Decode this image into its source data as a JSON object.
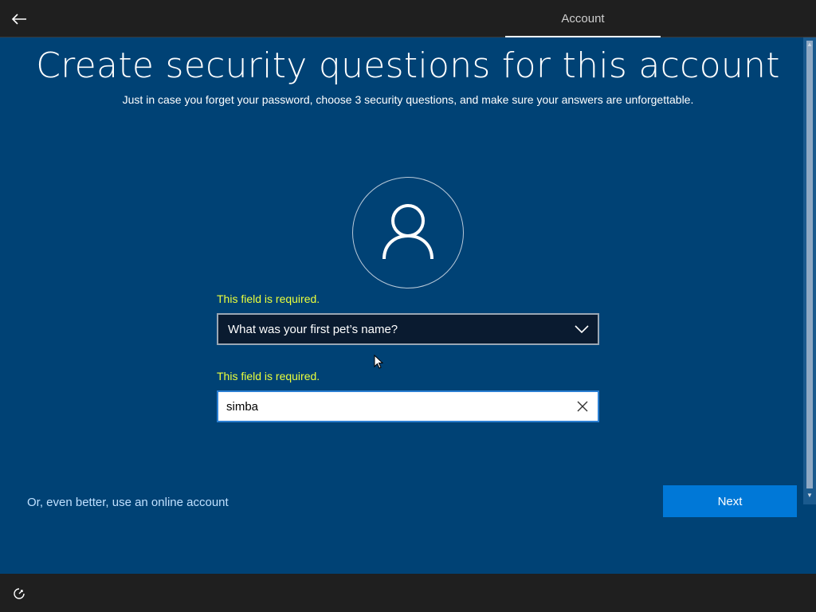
{
  "header": {
    "back_icon": "arrow-left-icon",
    "tab_label": "Account"
  },
  "main": {
    "title": "Create security questions for this account",
    "subtitle": "Just in case you forget your password, choose 3 security questions, and make sure your answers are unforgettable.",
    "avatar_icon": "user-icon",
    "question_error": "This field is required.",
    "question_selected": "What was your first pet’s name?",
    "answer_error": "This field is required.",
    "answer_value": "simba",
    "online_account_link": "Or, even better, use an online account",
    "next_label": "Next"
  },
  "footer": {
    "accessibility_icon": "ease-of-access-icon"
  },
  "colors": {
    "background": "#004275",
    "topbar": "#1f1f1f",
    "error_text": "#ebff3b",
    "accent": "#0078d7",
    "link": "#bfe0ff"
  }
}
